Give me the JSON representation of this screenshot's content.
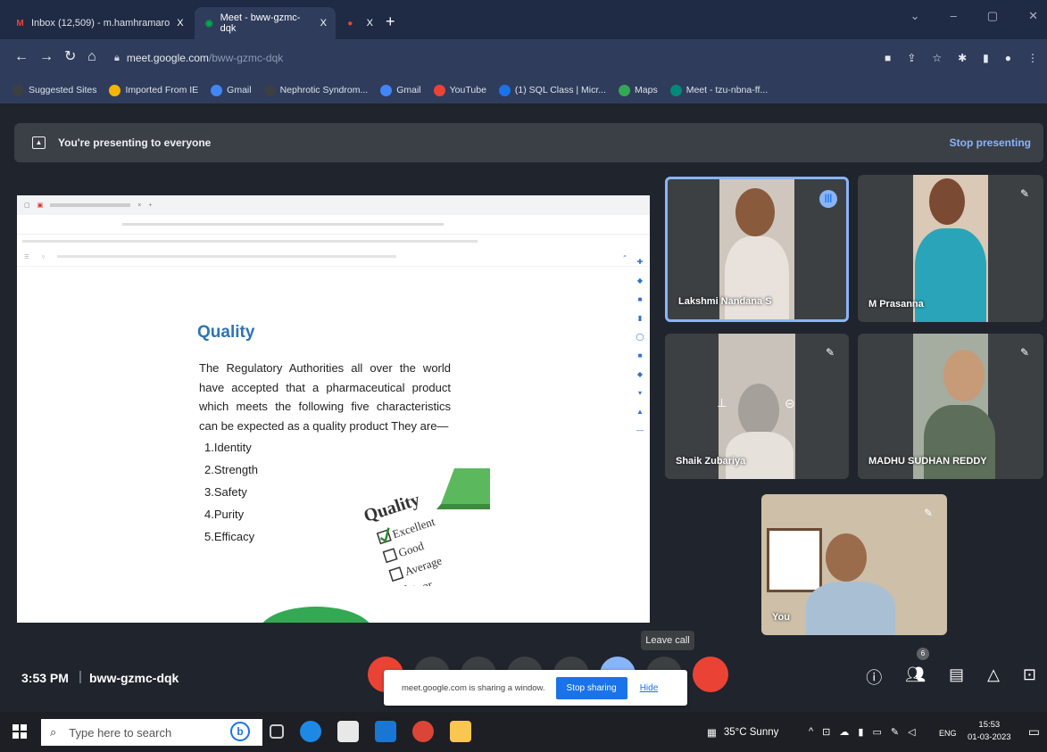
{
  "browser": {
    "tabs": [
      {
        "label": "Inbox (12,509) - m.hamhramaro",
        "favicon": "gmail-icon",
        "close": "X"
      },
      {
        "label": "Meet - bww-gzmc-dqk",
        "favicon": "meet-icon",
        "close": "X"
      },
      {
        "label": "",
        "favicon": "record-icon",
        "close": "X"
      }
    ],
    "new_tab": "+",
    "window_controls": [
      "⌄",
      "–",
      "▢",
      "✕"
    ],
    "url_host": "meet.google.com",
    "url_path": "/bww-gzmc-dqk",
    "bookmarks": [
      {
        "label": "Suggested Sites",
        "color": "#3c4043"
      },
      {
        "label": "Imported From IE",
        "color": "#f4b400"
      },
      {
        "label": "Gmail",
        "color": "#4285f4"
      },
      {
        "label": "Nephrotic Syndrom...",
        "color": "#3c4043"
      },
      {
        "label": "Gmail",
        "color": "#4285f4"
      },
      {
        "label": "YouTube",
        "color": "#ea4335"
      },
      {
        "label": "(1) SQL Class | Micr...",
        "color": "#1a73e8"
      },
      {
        "label": "Maps",
        "color": "#34a853"
      },
      {
        "label": "Meet - tzu-nbna-ff...",
        "color": "#00897b"
      }
    ]
  },
  "meet": {
    "banner_text": "You're presenting to everyone",
    "stop_presenting": "Stop presenting",
    "meeting_time": "3:53 PM",
    "separator": "|",
    "meeting_code": "bww-gzmc-dqk",
    "leave_tooltip": "Leave call",
    "participant_count": "6",
    "share_popup": {
      "message": "meet.google.com is sharing a window.",
      "stop_button": "Stop sharing",
      "hide_link": "Hide"
    },
    "participants": [
      {
        "name": "Lakshmi Nandana S",
        "state": "speaking"
      },
      {
        "name": "M Prasanna",
        "state": "muted"
      },
      {
        "name": "Shaik Zubariya",
        "state": "muted"
      },
      {
        "name": "MADHU SUDHAN REDDY",
        "state": "muted"
      },
      {
        "name": "You",
        "state": "muted"
      }
    ]
  },
  "document": {
    "heading": "Quality",
    "paragraph": "The Regulatory Authorities all over the world have accepted that a pharmaceutical product which meets the following five characteristics can be expected as a quality product They are—",
    "list": [
      "1.Identity",
      "2.Strength",
      "3.Safety",
      "4.Purity",
      "5.Efficacy"
    ],
    "image_words": [
      "Quality",
      "Excellent",
      "Good",
      "Average",
      "Poor"
    ]
  },
  "taskbar": {
    "search_placeholder": "Type here to search",
    "weather": "35°C Sunny",
    "language": "ENG",
    "time": "15:53",
    "date": "01-03-2023"
  }
}
